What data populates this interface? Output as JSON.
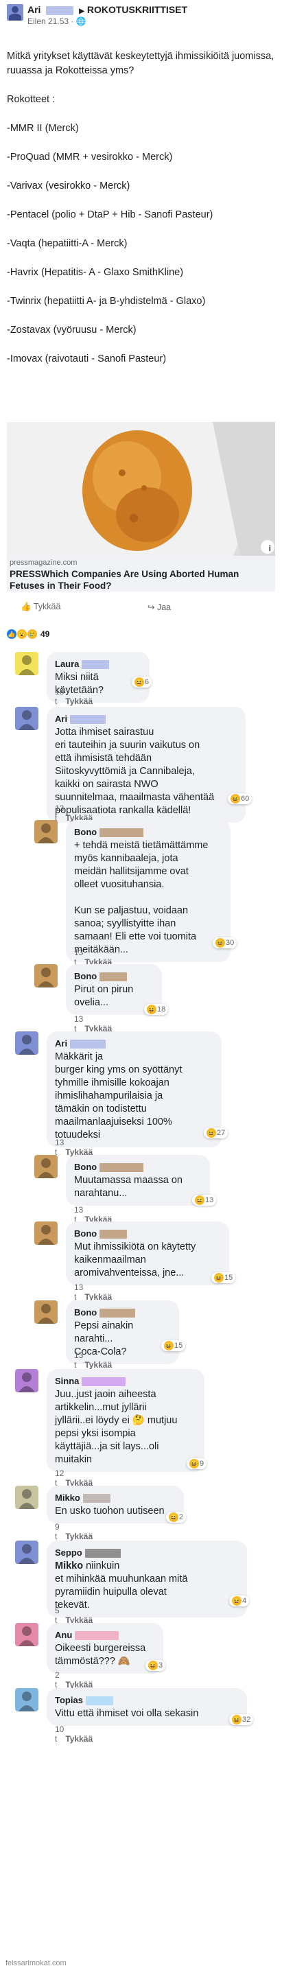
{
  "post": {
    "author": "Ari",
    "group": "ROKOTUSKRIITTISET",
    "time": "Eilen 21.53",
    "privacy_icon": "globe-icon",
    "intro": "Mitkä yritykset käyttävät keskeytettyjä ihmissikiöitä juomissa, ruuassa ja Rokotteissa yms?",
    "heading": "Rokotteet :",
    "lines": [
      "-MMR II (Merck)",
      "-ProQuad (MMR + vesirokko - Merck)",
      "-Varivax (vesirokko - Merck)",
      "-Pentacel (polio + DtaP + Hib - Sanofi Pasteur)",
      "-Vaqta (hepatiitti-A - Merck)",
      "-Havrix (Hepatitis- A - Glaxo SmithKline)",
      "-Twinrix (hepatiitti A- ja B-yhdistelmä - Glaxo)",
      "-Zostavax (vyöruusu - Merck)",
      "-Imovax (raivotauti - Sanofi Pasteur)"
    ],
    "link": {
      "domain": "pressmagazine.com",
      "title": "PRESSWhich Companies Are Using Aborted Human Fetuses in Their Food?",
      "info_icon": "info-icon"
    },
    "like_label": "Tykkää",
    "share_label": "Jaa",
    "reaction_count": "49"
  },
  "comments": [
    {
      "name": "Laura",
      "text": "Miksi niitä käytetään?",
      "time": "13 t",
      "like": "Tykkää",
      "react": "6",
      "avatar_color": "#f2e35c"
    },
    {
      "name": "Ari",
      "text": "Jotta ihmiset sairastuu\neri tauteihin ja suurin vaikutus on\nettä ihmisistä tehdään\nSiitoskyvyttömiä ja Cannibaleja,\nkaikki on sairasta NWO\nsuunnitelmaa, maailmasta vähentää\npopulisaatiota rankalla kädellä!",
      "time": "13 t",
      "like": "Tykkää",
      "react": "60",
      "avatar_color": "#7f8fd4"
    },
    {
      "name": "Bono",
      "text": "+ tehdä meistä tietämättämme\nmyös kannibaaleja, jota\nmeidän hallitsijamme ovat\nolleet vuosituhansia.\n\nKun se paljastuu, voidaan\nsanoa; syyllistyitte ihan\nsamaan! Eli ette voi tuomita\nmeitäkään...",
      "time": "13 t",
      "like": "Tykkää",
      "react": "30",
      "avatar_color": "#c99a5b"
    },
    {
      "name": "Bono",
      "text": "Pirut on pirun\novelia...",
      "time": "13 t",
      "like": "Tykkää",
      "react": "18",
      "avatar_color": "#c99a5b"
    },
    {
      "name": "Ari",
      "text": "Mäkkärit ja\nburger king yms on syöttänyt\ntyhmille ihmisille kokoajan\nihmislihahampurilaisia ja\ntämäkin on todistettu\nmaailmanlaajuiseksi 100%\ntotuudeksi",
      "time": "13 t",
      "like": "Tykkää",
      "react": "27",
      "avatar_color": "#7f8fd4"
    },
    {
      "name": "Bono",
      "text": "Muutamassa maassa on\nnarahtanu...",
      "time": "13 t",
      "like": "Tykkää",
      "react": "13",
      "avatar_color": "#c99a5b"
    },
    {
      "name": "Bono",
      "text": "Mut ihmissikiötä on käytetty\nkaikenmaailman\naromivahventeissa, jne...",
      "time": "13 t",
      "like": "Tykkää",
      "react": "15",
      "avatar_color": "#c99a5b"
    },
    {
      "name": "Bono",
      "text": "Pepsi ainakin narahti...\nCoca-Cola?",
      "time": "13 t",
      "like": "Tykkää",
      "react": "15",
      "avatar_color": "#c99a5b"
    },
    {
      "name": "Sinna",
      "text": "Juu..just jaoin aiheesta\nartikkelin...mut jyllärii\njyllärii..ei löydy ei 🤔 mutjuu\npepsi yksi isompia\nkäyttäjiä...ja sit lays...oli\nmuitakin",
      "time": "12 t",
      "like": "Tykkää",
      "react": "9",
      "avatar_color": "#b47fd6"
    },
    {
      "name": "Mikko",
      "text": "En usko tuohon uutiseen",
      "time": "9 t",
      "like": "Tykkää",
      "react": "2",
      "avatar_color": "#c8c4a0"
    },
    {
      "name": "Seppo",
      "mention": "Mikko",
      "text": "niinkuin\net mihinkää muuhunkaan mitä\npyramiidin huipulla olevat\ntekevät.",
      "time": "5 t",
      "like": "Tykkää",
      "react": "4",
      "avatar_color": "#7f8fd4"
    },
    {
      "name": "Anu",
      "text": "Oikeesti burgereissa\ntämmöstä??? 🙈",
      "time": "2 t",
      "like": "Tykkää",
      "react": "3",
      "avatar_color": "#e58aa8"
    },
    {
      "name": "Topias",
      "text": "Vittu että ihmiset voi olla sekasin",
      "time": "10 t",
      "like": "Tykkää",
      "react": "32",
      "avatar_color": "#7fb6e0"
    }
  ],
  "watermark": "feissarimokat.com",
  "colors": {
    "bubble": "#f0f2f5",
    "meta": "#65676b",
    "like": "#1877f2",
    "haha": "#f7b928"
  }
}
